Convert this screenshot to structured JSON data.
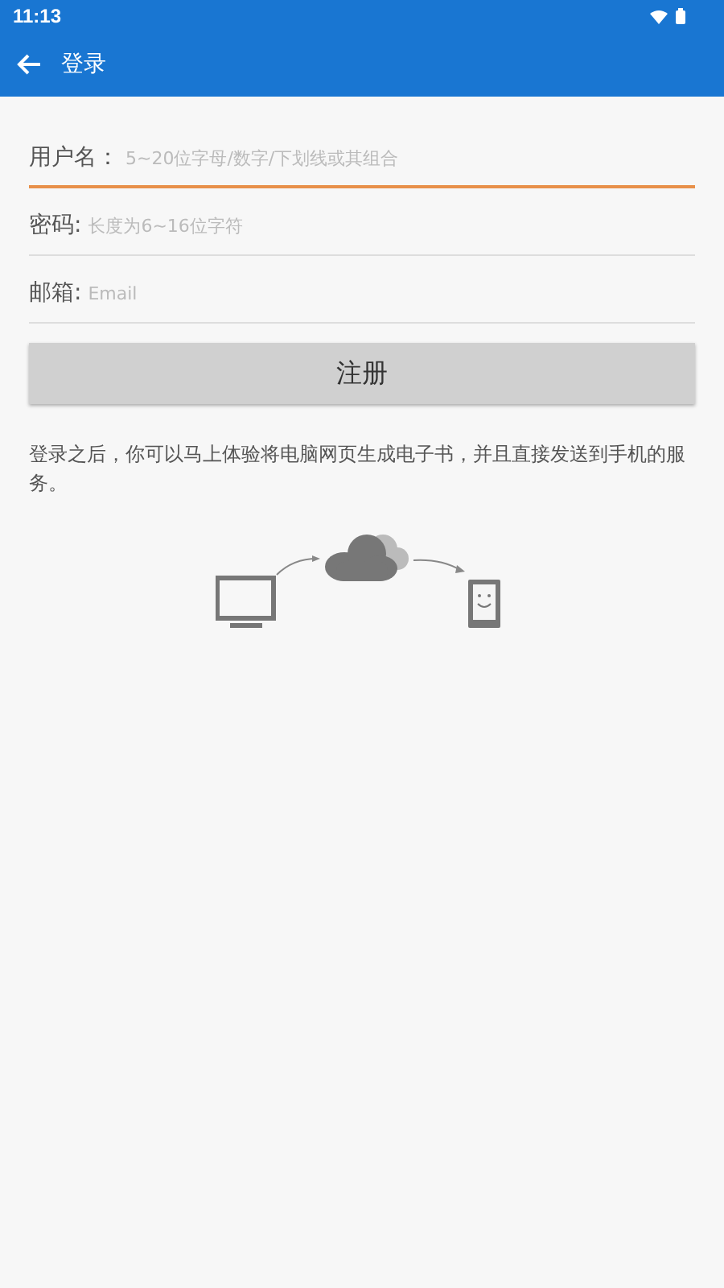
{
  "status_bar": {
    "time": "11:13"
  },
  "app_bar": {
    "title": "登录"
  },
  "fields": [
    {
      "label": "用户名：",
      "placeholder": "5~20位字母/数字/下划线或其组合",
      "focused": true
    },
    {
      "label": "密码:",
      "placeholder": "长度为6~16位字符",
      "focused": false
    },
    {
      "label": "邮箱:",
      "placeholder": "Email",
      "focused": false
    }
  ],
  "button": "注册",
  "description": "登录之后，你可以马上体验将电脑网页生成电子书，并且直接发送到手机的服务。"
}
